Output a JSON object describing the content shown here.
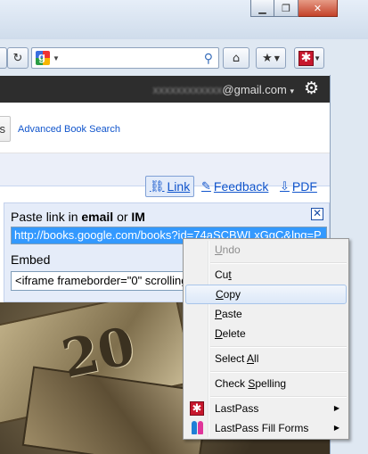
{
  "browser": {
    "window_buttons": [
      "minimize",
      "restore",
      "close"
    ],
    "menu_chevron": "▾"
  },
  "account": {
    "email": "@gmail.com",
    "blurred_name": "xxxxxxxxxxxx",
    "caret": "▾"
  },
  "search": {
    "button_label": "s",
    "advanced_link": "Advanced Book Search"
  },
  "toolbar": {
    "link_label": "Link",
    "feedback_label": "Feedback",
    "pdf_label": "PDF"
  },
  "panel": {
    "paste_prefix": "Paste link in ",
    "email_word": "email",
    "or_word": " or ",
    "im_word": "IM",
    "link_value": "http://books.google.com/books?id=74aSCBWLxGgC&lpg=P",
    "embed_label": "Embed",
    "embed_value": "<iframe frameborder=\"0\" scrolling=\"no\" style=\"border:0px\""
  },
  "image": {
    "bill_number": "20"
  },
  "context_menu": {
    "items": [
      {
        "label": "Undo",
        "underline": "U",
        "rest": "ndo",
        "disabled": true
      },
      {
        "label": "Cut",
        "underline": "t",
        "rest": "",
        "prefix": "Cu"
      },
      {
        "label": "Copy",
        "underline": "C",
        "rest": "opy",
        "hover": true
      },
      {
        "label": "Paste",
        "underline": "P",
        "rest": "aste"
      },
      {
        "label": "Delete",
        "underline": "D",
        "rest": "elete"
      },
      {
        "label": "Select All",
        "prefix": "Select ",
        "underline": "A",
        "rest": "ll"
      },
      {
        "label": "Check Spelling",
        "prefix": "Check ",
        "underline": "S",
        "rest": "pelling"
      },
      {
        "label": "LastPass",
        "submenu": true,
        "icon": "lastpass-icon"
      },
      {
        "label": "LastPass Fill Forms",
        "submenu": true,
        "icon": "fill-forms-icon"
      }
    ]
  },
  "colors": {
    "link": "#1155cc",
    "selection": "#3399ff",
    "lastpass": "#c7172d",
    "dark_bar": "#2d2d2d"
  }
}
